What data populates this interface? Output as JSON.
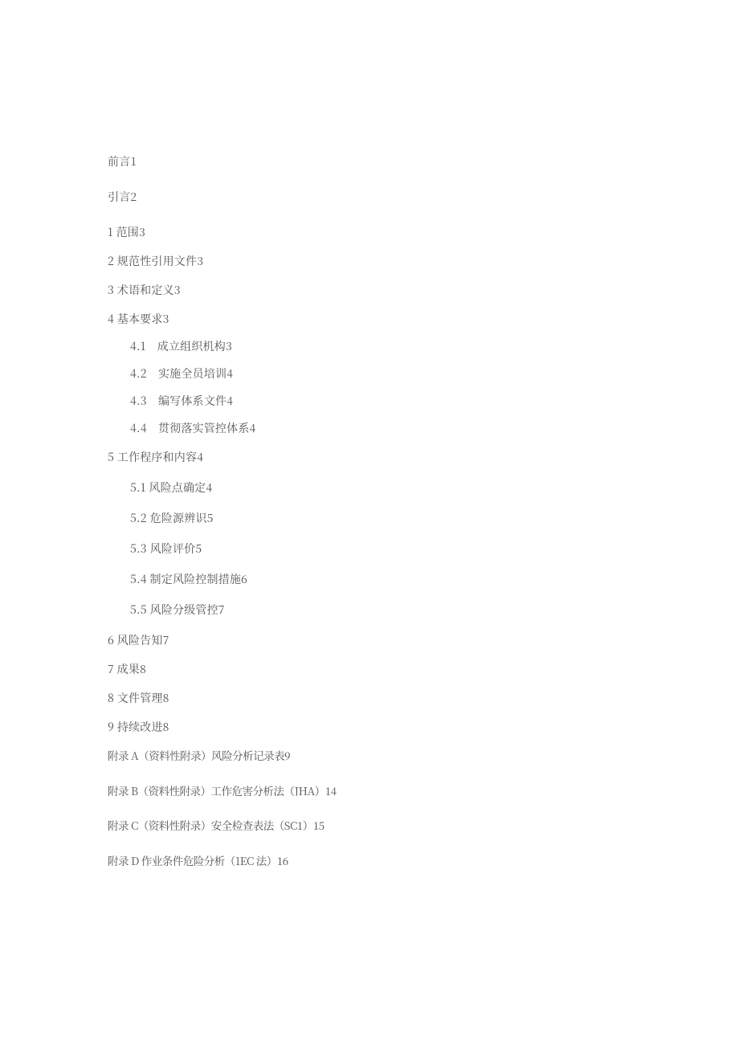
{
  "toc": [
    {
      "indent": 0,
      "mb": 30,
      "title": "前言 ",
      "page": " 1",
      "dots": "space-dot"
    },
    {
      "indent": 0,
      "mb": 30,
      "title": "引言 ",
      "page": " 2",
      "dots": "space-dot"
    },
    {
      "indent": 0,
      "mb": 22,
      "title": "1 范围",
      "page": " 3",
      "dots": "space-dot"
    },
    {
      "indent": 0,
      "mb": 22,
      "title": "2 规范性引用文件 ",
      "page": " 3",
      "dots": "space-dot"
    },
    {
      "indent": 0,
      "mb": 22,
      "title": "3 术语和定义 ",
      "page": " 3",
      "dots": "space-dot"
    },
    {
      "indent": 0,
      "mb": 20,
      "title": "4 基本要求 ",
      "page": " 3",
      "dots": "space-dot"
    },
    {
      "indent": 28,
      "mb": 20,
      "title": "4.1　成立组织机构 ",
      "page": " 3",
      "dots": "space-dot"
    },
    {
      "indent": 28,
      "mb": 20,
      "title": "4.2　实施全员培训 ",
      "page": " 4",
      "dots": "space-dot"
    },
    {
      "indent": 28,
      "mb": 20,
      "title": "4.3　编写体系文件 ",
      "page": " 4",
      "dots": "space-dot"
    },
    {
      "indent": 28,
      "mb": 22,
      "title": "4.4　贯彻落实管控体系 ",
      "page": " 4",
      "dots": "space-dot"
    },
    {
      "indent": 0,
      "mb": 24,
      "title": "5 工作程序和内容 ",
      "page": " 4",
      "dots": "space-dot"
    },
    {
      "indent": 28,
      "mb": 24,
      "title": "5.1 风险点确定 ",
      "page": " 4",
      "dots": "space-dot"
    },
    {
      "indent": 28,
      "mb": 24,
      "title": "5.2 危险源辨识 ",
      "page": " 5",
      "dots": "space-dot"
    },
    {
      "indent": 28,
      "mb": 24,
      "title": "5.3 风险评价 ",
      "page": " 5",
      "dots": "space-dot"
    },
    {
      "indent": 28,
      "mb": 24,
      "title": "5.4 制定风险控制措施 ",
      "page": " 6",
      "dots": "space-dot"
    },
    {
      "indent": 28,
      "mb": 24,
      "title": "5.5 风险分级管控 ",
      "page": " 7",
      "dots": "space-dot"
    },
    {
      "indent": 0,
      "mb": 22,
      "title": "6 风险告知 ",
      "page": " 7",
      "dots": "space-dot"
    },
    {
      "indent": 0,
      "mb": 22,
      "title": "7 成果 ",
      "page": " 8",
      "dots": "space-dot"
    },
    {
      "indent": 0,
      "mb": 22,
      "title": "8 文件管理 ",
      "page": " 8",
      "dots": "space-dot"
    },
    {
      "indent": 0,
      "mb": 22,
      "title": "9 持续改进 ",
      "page": " 8",
      "dots": "space-dot"
    },
    {
      "indent": 0,
      "mb": 30,
      "title": "附录 A（资料性附录）风险分析记录表",
      "page": " 9",
      "dots": "space-dot",
      "cls": "tight-cjk"
    },
    {
      "indent": 0,
      "mb": 30,
      "title": "附录 B（资料性附录）工作危害分析法（JHA） ",
      "page": "14",
      "dots": "tight-dot",
      "cls": "tight-cjk"
    },
    {
      "indent": 0,
      "mb": 30,
      "title": "附录 C（资料性附录）安全检查表法（SC1）",
      "page": "15",
      "dots": "tight-dot",
      "cls": "tight-cjk"
    },
    {
      "indent": 0,
      "mb": 0,
      "title": "附录 D 作业条件危险分析（1EC 法） ",
      "page": " 16",
      "dots": "space-dot",
      "cls": "tight-cjk"
    }
  ]
}
